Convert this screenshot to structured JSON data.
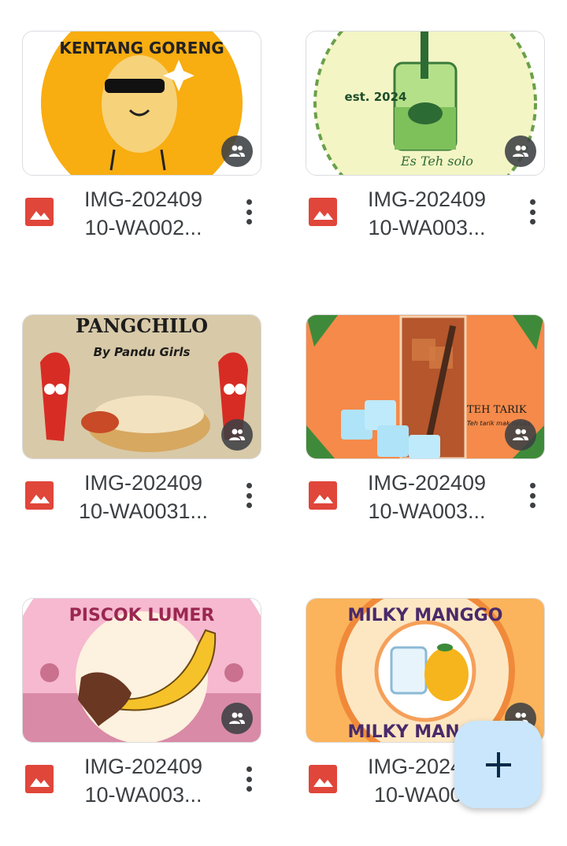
{
  "files": [
    {
      "name_line1": "IMG-202409",
      "name_line2": "10-WA002...",
      "thumb_text": "KENTANG GORENG",
      "shared": true
    },
    {
      "name_line1": "IMG-202409",
      "name_line2": "10-WA003...",
      "thumb_text": "est. 2024",
      "shared": true
    },
    {
      "name_line1": "IMG-202409",
      "name_line2": "10-WA0031...",
      "thumb_text": "PANGCHILO",
      "thumb_subtext": "By Pandu Girls",
      "shared": true
    },
    {
      "name_line1": "IMG-202409",
      "name_line2": "10-WA003...",
      "thumb_text": "TEH TARIK",
      "thumb_subtext": "Teh tarik mak nyuss",
      "shared": true
    },
    {
      "name_line1": "IMG-202409",
      "name_line2": "10-WA003...",
      "thumb_text": "PISCOK LUMER",
      "shared": true
    },
    {
      "name_line1": "IMG-202409",
      "name_line2": "10-WA00...",
      "thumb_text": "MILKY MANGGO",
      "thumb_subtext": "MILKY MANGGO",
      "shared": true
    }
  ],
  "fab": {
    "icon": "plus-icon",
    "color": "#c9e6fc"
  },
  "colors": {
    "image_file_icon": "#e0463a",
    "text": "#3c4043",
    "border": "#dadce0"
  }
}
